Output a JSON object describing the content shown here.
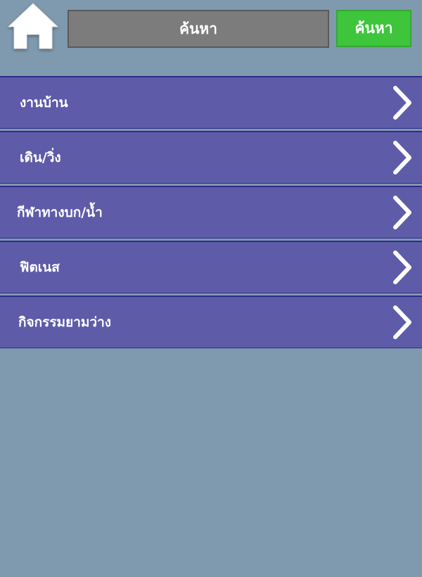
{
  "header": {
    "search_placeholder": "ค้นหา",
    "search_button_label": "ค้นหา"
  },
  "colors": {
    "background": "#7f99ae",
    "search_input_bg": "#7c7c7c",
    "search_button_bg": "#3ec53b",
    "list_item_bg": "#5e5ba9",
    "list_item_border": "#2e2c8a"
  },
  "icons": {
    "home": "home-icon",
    "chevron": "chevron-right-icon"
  },
  "categories": [
    {
      "label": "งานบ้าน"
    },
    {
      "label": "เดิน/วิ่ง"
    },
    {
      "label": "กีฬาทางบก/น้ำ"
    },
    {
      "label": "ฟิตเนส"
    },
    {
      "label": "กิจกรรมยามว่าง"
    }
  ]
}
